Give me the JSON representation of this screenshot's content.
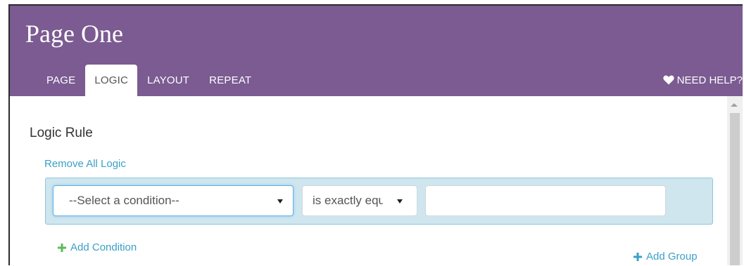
{
  "header": {
    "title": "Page One",
    "help_label": "NEED HELP?",
    "background_color": "#7b5b92"
  },
  "tabs": [
    {
      "label": "PAGE",
      "active": false
    },
    {
      "label": "LOGIC",
      "active": true
    },
    {
      "label": "LAYOUT",
      "active": false
    },
    {
      "label": "REPEAT",
      "active": false
    }
  ],
  "logic": {
    "title": "Logic Rule",
    "remove_all_label": "Remove All Logic",
    "condition_select": "--Select a condition--",
    "operator_select": "is exactly equal to",
    "value_input": "",
    "add_condition_label": "Add Condition",
    "add_group_label": "Add Group",
    "link_color": "#3aa0c8",
    "plus_condition_color": "#5cb85c",
    "plus_group_color": "#3aa0c8"
  },
  "icons": {
    "help": "heart-icon",
    "add_condition": "plus-icon",
    "add_group": "plus-icon"
  }
}
